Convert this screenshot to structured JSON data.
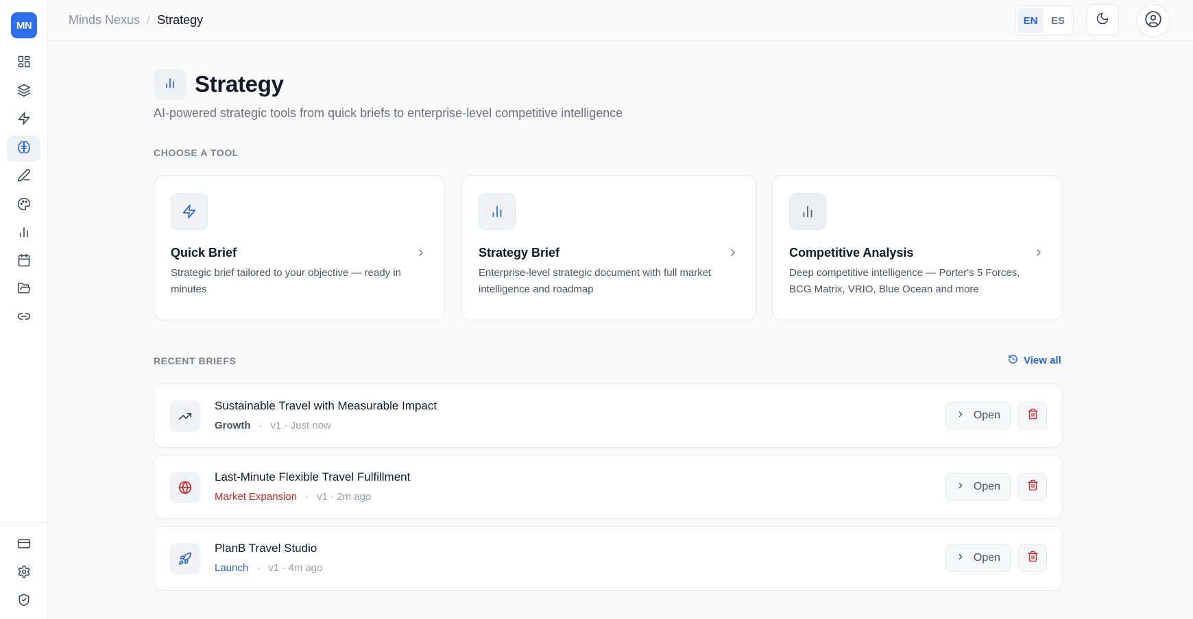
{
  "app": {
    "logo": "MN"
  },
  "sidebar": {
    "items": [
      {
        "name": "dashboard-icon"
      },
      {
        "name": "layers-icon"
      },
      {
        "name": "lightning-icon"
      },
      {
        "name": "brain-icon",
        "active": true
      },
      {
        "name": "pen-icon"
      },
      {
        "name": "palette-icon"
      },
      {
        "name": "bar-chart-icon"
      },
      {
        "name": "calendar-icon"
      },
      {
        "name": "folder-icon"
      },
      {
        "name": "link-icon"
      }
    ],
    "bottom_items": [
      {
        "name": "credit-card-icon"
      },
      {
        "name": "gear-icon"
      },
      {
        "name": "shield-check-icon"
      }
    ]
  },
  "header": {
    "breadcrumb_root": "Minds Nexus",
    "breadcrumb_sep": "/",
    "breadcrumb_current": "Strategy",
    "lang_en": "EN",
    "lang_es": "ES",
    "lang_active": "EN"
  },
  "page": {
    "title": "Strategy",
    "subtitle": "AI-powered strategic tools from quick briefs to enterprise-level competitive intelligence",
    "choose_label": "CHOOSE A TOOL",
    "recent_label": "RECENT BRIEFS",
    "view_all": "View all"
  },
  "tools": [
    {
      "title": "Quick Brief",
      "desc": "Strategic brief tailored to your objective — ready in minutes",
      "icon": "lightning-icon"
    },
    {
      "title": "Strategy Brief",
      "desc": "Enterprise-level strategic document with full market intelligence and roadmap",
      "icon": "bar-chart-icon"
    },
    {
      "title": "Competitive Analysis",
      "desc": "Deep competitive intelligence — Porter's 5 Forces, BCG Matrix, VRIO, Blue Ocean and more",
      "icon": "bar-chart-icon"
    }
  ],
  "briefs": [
    {
      "title": "Sustainable Travel with Measurable Impact",
      "tag": "Growth",
      "dot": "·",
      "meta": "v1 · Just now",
      "icon": "trending-up-icon",
      "tag_color": "#4b5563"
    },
    {
      "title": "Last-Minute Flexible Travel Fulfillment",
      "tag": "Market Expansion",
      "dot": "·",
      "meta": "v1 · 2m ago",
      "icon": "globe-icon",
      "tag_color": "#dc2626"
    },
    {
      "title": "PlanB Travel Studio",
      "tag": "Launch",
      "dot": "·",
      "meta": "v1 · 4m ago",
      "icon": "rocket-icon",
      "tag_color": "#2563eb"
    }
  ],
  "actions": {
    "open_label": "Open"
  },
  "colors": {
    "accent": "#2563eb",
    "danger": "#dc2626",
    "logo_bg": "#2d6ef0"
  }
}
